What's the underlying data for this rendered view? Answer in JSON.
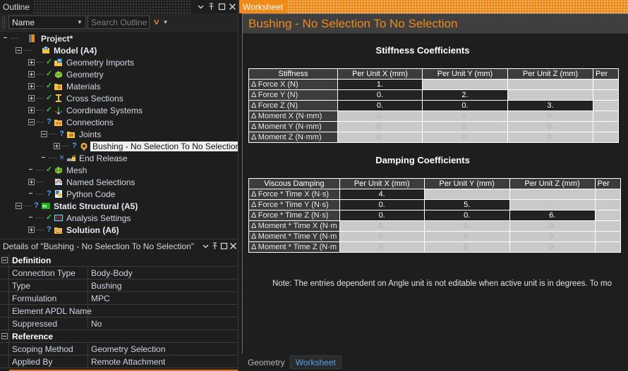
{
  "outline": {
    "title": "Outline",
    "window_buttons": [
      "chevron-down",
      "pin",
      "maximize",
      "close"
    ],
    "toolbar": {
      "filter_value": "Name",
      "search_placeholder": "Search Outline",
      "expand_chevron": "v",
      "more_chevron": "v"
    },
    "tree": [
      {
        "label": "Project*",
        "indent": 0,
        "expander": "none",
        "mark": "",
        "icon": "project-icon",
        "bold": true,
        "selected": false
      },
      {
        "label": "Model (A4)",
        "indent": 1,
        "expander": "minus",
        "mark": "",
        "icon": "model-icon",
        "bold": true,
        "selected": false
      },
      {
        "label": "Geometry Imports",
        "indent": 2,
        "expander": "plus",
        "mark": "ok",
        "icon": "geometry-imports-icon",
        "bold": false,
        "selected": false
      },
      {
        "label": "Geometry",
        "indent": 2,
        "expander": "plus",
        "mark": "ok",
        "icon": "geometry-icon",
        "bold": false,
        "selected": false
      },
      {
        "label": "Materials",
        "indent": 2,
        "expander": "plus",
        "mark": "ok",
        "icon": "materials-icon",
        "bold": false,
        "selected": false
      },
      {
        "label": "Cross Sections",
        "indent": 2,
        "expander": "plus",
        "mark": "ok",
        "icon": "cross-sections-icon",
        "bold": false,
        "selected": false
      },
      {
        "label": "Coordinate Systems",
        "indent": 2,
        "expander": "plus",
        "mark": "ok",
        "icon": "coordinate-systems-icon",
        "bold": false,
        "selected": false
      },
      {
        "label": "Connections",
        "indent": 2,
        "expander": "minus",
        "mark": "q",
        "icon": "connections-icon",
        "bold": false,
        "selected": false
      },
      {
        "label": "Joints",
        "indent": 3,
        "expander": "minus",
        "mark": "q",
        "icon": "joints-icon",
        "bold": false,
        "selected": false
      },
      {
        "label": "Bushing - No Selection To No Selection",
        "indent": 4,
        "expander": "plus",
        "mark": "q",
        "icon": "bushing-icon",
        "bold": false,
        "selected": true
      },
      {
        "label": "End Release",
        "indent": 3,
        "expander": "none",
        "mark": "x",
        "icon": "end-release-icon",
        "bold": false,
        "selected": false
      },
      {
        "label": "Mesh",
        "indent": 2,
        "expander": "none",
        "mark": "ok",
        "icon": "mesh-icon",
        "bold": false,
        "selected": false
      },
      {
        "label": "Named Selections",
        "indent": 2,
        "expander": "plus",
        "mark": "",
        "icon": "named-selections-icon",
        "bold": false,
        "selected": false
      },
      {
        "label": "Python Code",
        "indent": 2,
        "expander": "none",
        "mark": "q",
        "icon": "python-code-icon",
        "bold": false,
        "selected": false
      },
      {
        "label": "Static Structural (A5)",
        "indent": 1,
        "expander": "minus",
        "mark": "q",
        "icon": "static-structural-icon",
        "bold": true,
        "selected": false
      },
      {
        "label": "Analysis Settings",
        "indent": 2,
        "expander": "none",
        "mark": "ok",
        "icon": "analysis-settings-icon",
        "bold": false,
        "selected": false
      },
      {
        "label": "Solution (A6)",
        "indent": 2,
        "expander": "plus",
        "mark": "q",
        "icon": "solution-icon",
        "bold": true,
        "selected": false
      }
    ]
  },
  "details": {
    "title": "Details of \"Bushing - No Selection To No Selection\"",
    "window_buttons": [
      "chevron-down",
      "pin",
      "maximize",
      "close"
    ],
    "rows": [
      {
        "kind": "header",
        "name": "Definition",
        "value": ""
      },
      {
        "kind": "row",
        "name": "Connection Type",
        "value": "Body-Body"
      },
      {
        "kind": "row",
        "name": "Type",
        "value": "Bushing"
      },
      {
        "kind": "row",
        "name": "Formulation",
        "value": "MPC"
      },
      {
        "kind": "row",
        "name": "Element APDL Name",
        "value": ""
      },
      {
        "kind": "row",
        "name": "Suppressed",
        "value": "No"
      },
      {
        "kind": "header",
        "name": "Reference",
        "value": ""
      },
      {
        "kind": "row",
        "name": "Scoping Method",
        "value": "Geometry Selection"
      },
      {
        "kind": "row",
        "name": "Applied By",
        "value": "Remote Attachment"
      }
    ]
  },
  "worksheet": {
    "panel_title": "Worksheet",
    "heading": "Bushing - No Selection To No Selection",
    "stiffness": {
      "title": "Stiffness Coefficients",
      "corner_header": "Stiffness",
      "columns": [
        "Per Unit X (mm)",
        "Per Unit Y (mm)",
        "Per Unit Z (mm)",
        "Per "
      ],
      "rows": [
        {
          "label": "Δ Force X (N)",
          "cells": [
            {
              "v": "1.",
              "s": "edit"
            },
            {
              "v": "",
              "s": "blank"
            },
            {
              "v": "",
              "s": "blank"
            },
            {
              "v": "",
              "s": "blank"
            }
          ]
        },
        {
          "label": "Δ Force Y (N)",
          "cells": [
            {
              "v": "0.",
              "s": "edit"
            },
            {
              "v": "2.",
              "s": "edit"
            },
            {
              "v": "",
              "s": "blank"
            },
            {
              "v": "",
              "s": "blank"
            }
          ]
        },
        {
          "label": "Δ Force Z (N)",
          "cells": [
            {
              "v": "0.",
              "s": "edit"
            },
            {
              "v": "0.",
              "s": "edit"
            },
            {
              "v": "3.",
              "s": "edit"
            },
            {
              "v": "",
              "s": "blank"
            }
          ]
        },
        {
          "label": "Δ Moment X (N·mm)",
          "cells": [
            {
              "v": "0.",
              "s": "grey"
            },
            {
              "v": "0.",
              "s": "grey"
            },
            {
              "v": "0.",
              "s": "grey"
            },
            {
              "v": "",
              "s": "blank"
            }
          ]
        },
        {
          "label": "Δ Moment Y (N·mm)",
          "cells": [
            {
              "v": "0.",
              "s": "grey"
            },
            {
              "v": "0.",
              "s": "grey"
            },
            {
              "v": "0.",
              "s": "grey"
            },
            {
              "v": "",
              "s": "blank"
            }
          ]
        },
        {
          "label": "Δ Moment Z (N·mm)",
          "cells": [
            {
              "v": "0.",
              "s": "grey"
            },
            {
              "v": "0.",
              "s": "grey"
            },
            {
              "v": "0.",
              "s": "grey"
            },
            {
              "v": "",
              "s": "blank"
            }
          ]
        }
      ]
    },
    "damping": {
      "title": "Damping Coefficients",
      "corner_header": "Viscous Damping",
      "columns": [
        "Per Unit X (mm)",
        "Per Unit Y (mm)",
        "Per Unit Z (mm)",
        "Per "
      ],
      "rows": [
        {
          "label": "Δ Force * Time X (N·s)",
          "cells": [
            {
              "v": "4.",
              "s": "edit"
            },
            {
              "v": "",
              "s": "blank"
            },
            {
              "v": "",
              "s": "blank"
            },
            {
              "v": "",
              "s": "blank"
            }
          ]
        },
        {
          "label": "Δ Force * Time Y (N·s)",
          "cells": [
            {
              "v": "0.",
              "s": "edit"
            },
            {
              "v": "5.",
              "s": "edit"
            },
            {
              "v": "",
              "s": "blank"
            },
            {
              "v": "",
              "s": "blank"
            }
          ]
        },
        {
          "label": "Δ Force * Time Z (N·s)",
          "cells": [
            {
              "v": "0.",
              "s": "edit"
            },
            {
              "v": "0.",
              "s": "edit"
            },
            {
              "v": "6.",
              "s": "edit"
            },
            {
              "v": "",
              "s": "blank"
            }
          ]
        },
        {
          "label": "Δ Moment * Time X (N·m",
          "cells": [
            {
              "v": "0.",
              "s": "grey"
            },
            {
              "v": "0.",
              "s": "grey"
            },
            {
              "v": "0.",
              "s": "grey"
            },
            {
              "v": "",
              "s": "blank"
            }
          ]
        },
        {
          "label": "Δ Moment * Time Y (N·m",
          "cells": [
            {
              "v": "0.",
              "s": "grey"
            },
            {
              "v": "0.",
              "s": "grey"
            },
            {
              "v": "0.",
              "s": "grey"
            },
            {
              "v": "",
              "s": "blank"
            }
          ]
        },
        {
          "label": "Δ Moment * Time Z (N·m",
          "cells": [
            {
              "v": "0.",
              "s": "grey"
            },
            {
              "v": "0.",
              "s": "grey"
            },
            {
              "v": "0.",
              "s": "grey"
            },
            {
              "v": "",
              "s": "blank"
            }
          ]
        }
      ]
    },
    "note": "Note: The entries dependent on Angle unit is not editable when active unit is in degrees. To mo",
    "tabs": [
      {
        "label": "Geometry",
        "active": false
      },
      {
        "label": "Worksheet",
        "active": true
      }
    ]
  },
  "colors": {
    "accent_orange": "#ef8a1b",
    "title_orange": "#f08a1e",
    "tab_blue": "#4ea3f2",
    "ok_green": "#3fc13f",
    "panel_bg": "#1e1e1e",
    "table_header": "#3c3c3c",
    "cell_disabled": "#c9c9c9"
  }
}
